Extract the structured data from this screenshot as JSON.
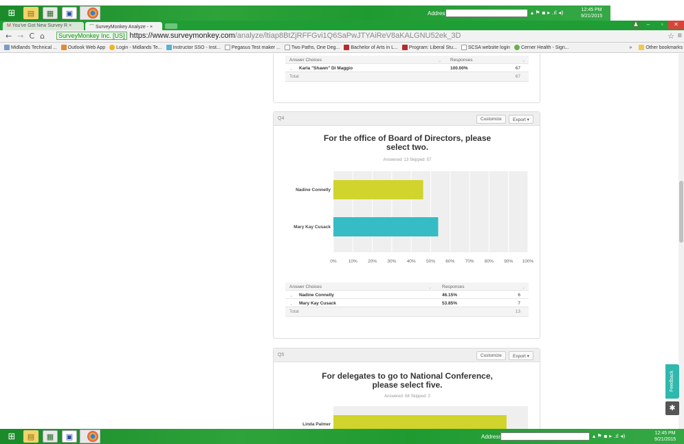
{
  "taskbar": {
    "address_label": "Address",
    "time": "12:45 PM",
    "date": "9/21/2015"
  },
  "browser": {
    "tabs": [
      {
        "label": "You've Got New Survey R",
        "close": "×"
      },
      {
        "label": "SurveyMonkey Analyze - ",
        "close": "×"
      }
    ],
    "secure_label": "SurveyMonkey Inc. [US]",
    "url_host": "https://www.surveymonkey.com",
    "url_path": "/analyze/ltiap8BtZjRFFGvi1Q6SaPwJTYAiReV8aKALGNU52ek_3D",
    "bookmarks": [
      "Midlands Technical ...",
      "Outlook Web App",
      "Login - Midlands Te...",
      "Instructor SSO - Inst...",
      "Pegasus Test maker ...",
      "Two Paths, One Deg...",
      "Bachelor of Arts in L...",
      "Program: Liberal Stu...",
      "SCSA website login",
      "Cerner Health - Sign..."
    ],
    "other_bookmarks": "Other bookmarks",
    "bookmarks_more": "»"
  },
  "q3_tail": {
    "header": {
      "choices": "Answer Choices",
      "responses": "Responses"
    },
    "rows": [
      {
        "name": "Karla \"Shawn\" Di Maggio",
        "pct": "100.00%",
        "count": "67"
      }
    ],
    "total_label": "Total",
    "total": "67"
  },
  "q4": {
    "number": "Q4",
    "customize": "Customize",
    "export": "Export ▾",
    "title_line1": "For the office of Board of Directors, please",
    "title_line2": "select two.",
    "stats": "Answered: 13    Skipped: 57",
    "header": {
      "choices": "Answer Choices",
      "responses": "Responses"
    },
    "rows": [
      {
        "name": "Nadine Connelly",
        "pct": "46.15%",
        "count": "6"
      },
      {
        "name": "Mary Kay Cusack",
        "pct": "53.85%",
        "count": "7"
      }
    ],
    "total_label": "Total",
    "total": "13"
  },
  "q5": {
    "number": "Q5",
    "customize": "Customize",
    "export": "Export ▾",
    "title_line1": "For delegates to go to National Conference,",
    "title_line2": "please select five.",
    "stats": "Answered: 68    Skipped: 2"
  },
  "feedback": "Feedback",
  "chart_data": [
    {
      "type": "bar",
      "orientation": "horizontal",
      "categories": [
        "Nadine Connelly",
        "Mary Kay Cusack"
      ],
      "values": [
        46.15,
        53.85
      ],
      "colors": [
        "#d0d42c",
        "#36bcc4"
      ],
      "xlim": [
        0,
        100
      ],
      "ticks": [
        "0%",
        "10%",
        "20%",
        "30%",
        "40%",
        "50%",
        "60%",
        "70%",
        "80%",
        "90%",
        "100%"
      ],
      "grid": true
    },
    {
      "type": "bar",
      "orientation": "horizontal",
      "categories": [
        "Linda Palmer"
      ],
      "values": [
        89
      ],
      "colors": [
        "#d0d42c"
      ],
      "xlim": [
        0,
        100
      ]
    }
  ]
}
